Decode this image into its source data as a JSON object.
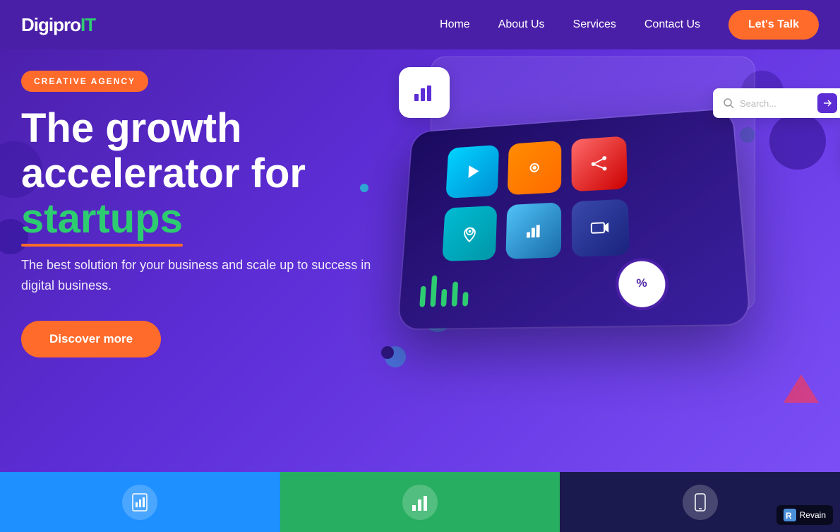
{
  "navbar": {
    "logo_text": "DigiproIT",
    "logo_green": "IT",
    "links": [
      {
        "label": "Home",
        "id": "home"
      },
      {
        "label": "About Us",
        "id": "about"
      },
      {
        "label": "Services",
        "id": "services"
      },
      {
        "label": "Contact Us",
        "id": "contact"
      }
    ],
    "cta_label": "Let's Talk"
  },
  "hero": {
    "badge_text": "CREATIVE AGENCY",
    "title_line1": "The growth",
    "title_line2": "accelerator for",
    "title_accent": "startups",
    "subtitle": "The best solution for your business and scale up to success in digital business.",
    "cta_label": "Discover more",
    "search_placeholder": "Search..."
  },
  "bottom_cards": [
    {
      "id": "analytics",
      "icon": "📊"
    },
    {
      "id": "chart",
      "icon": "📈"
    },
    {
      "id": "mobile",
      "icon": "📱"
    }
  ],
  "revain": {
    "label": "Revain"
  },
  "colors": {
    "hero_bg": "#5c2dd5",
    "accent_orange": "#ff6b2b",
    "accent_green": "#2ecc71",
    "nav_bg": "#4a1fa8"
  }
}
